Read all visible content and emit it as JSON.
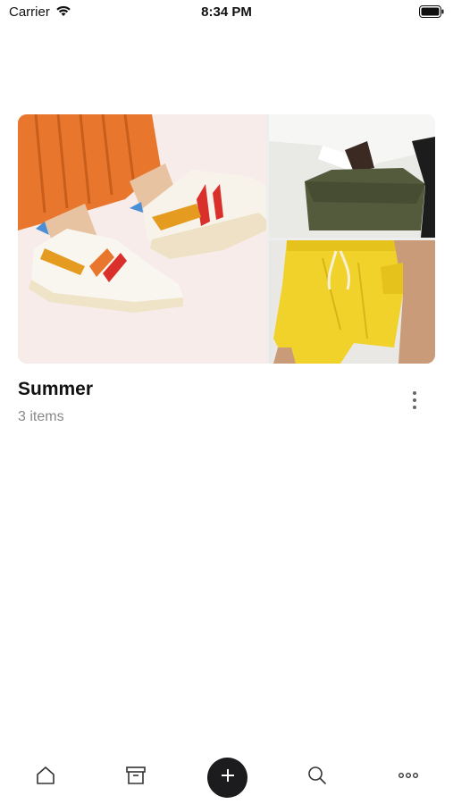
{
  "status_bar": {
    "carrier": "Carrier",
    "time": "8:34 PM"
  },
  "collection": {
    "title": "Summer",
    "subtitle": "3 items",
    "images": [
      {
        "icon": "sneakers-photo"
      },
      {
        "icon": "handbag-photo"
      },
      {
        "icon": "yellow-shorts-photo"
      }
    ]
  },
  "tab_bar": {
    "items": [
      {
        "icon": "home-icon"
      },
      {
        "icon": "archive-icon"
      },
      {
        "icon": "add-icon"
      },
      {
        "icon": "search-icon"
      },
      {
        "icon": "more-horizontal-icon"
      }
    ]
  },
  "colors": {
    "background": "#ffffff",
    "accent_dark": "#1c1c1e",
    "subtitle_gray": "#888888"
  }
}
